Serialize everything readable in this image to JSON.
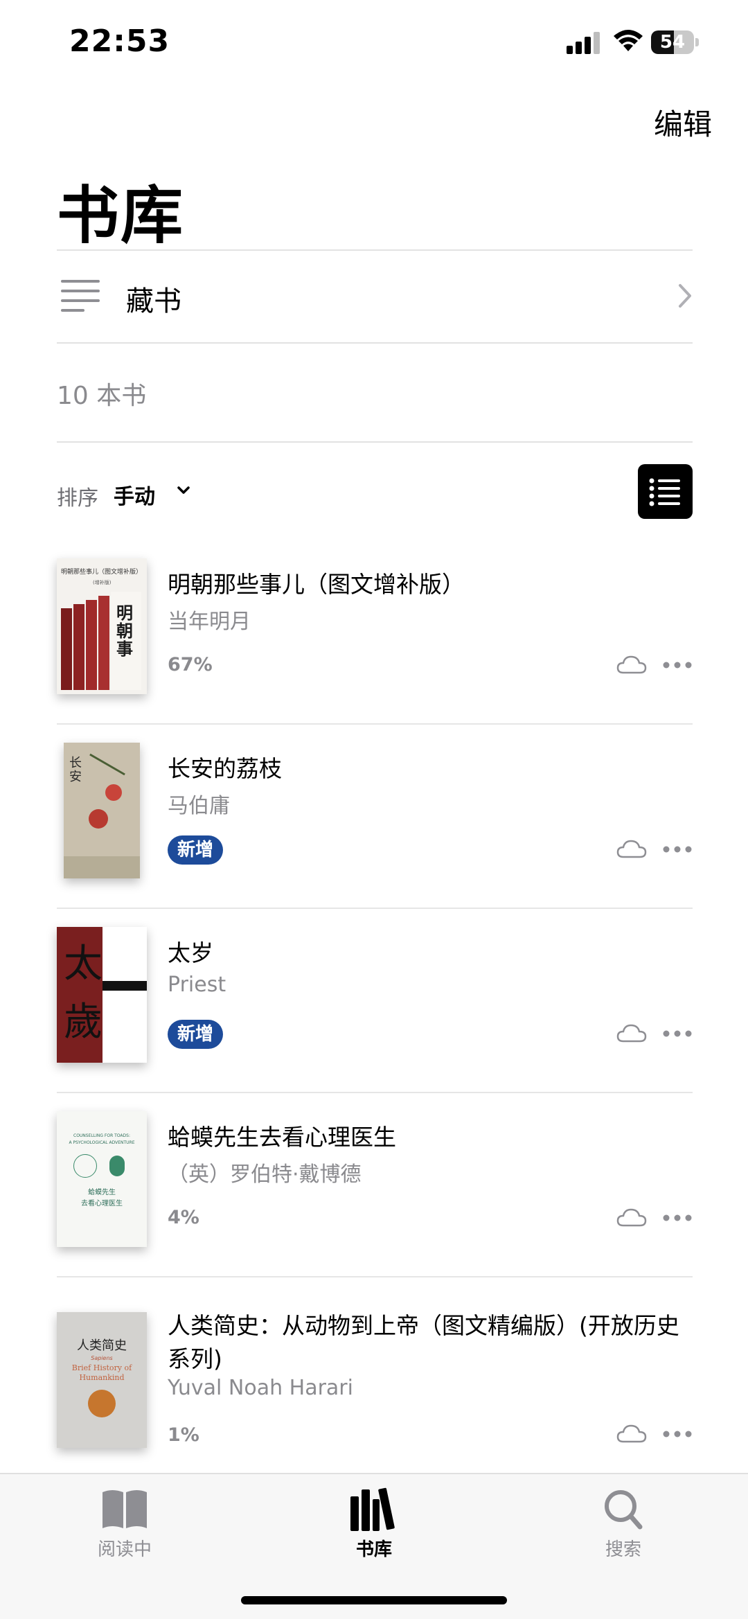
{
  "status": {
    "time": "22:53",
    "battery": "54",
    "battery_level": 0.54
  },
  "header": {
    "edit_label": "编辑",
    "title": "书库"
  },
  "collection": {
    "label": "藏书"
  },
  "book_count": "10 本书",
  "sort": {
    "label": "排序",
    "value": "手动"
  },
  "books": [
    {
      "title": "明朝那些事儿（图文增补版）",
      "author": "当年明月",
      "progress": "67%"
    },
    {
      "title": "长安的荔枝",
      "author": "马伯庸",
      "badge": "新增"
    },
    {
      "title": "太岁",
      "author": "Priest",
      "badge": "新增"
    },
    {
      "title": "蛤蟆先生去看心理医生",
      "author": "（英）罗伯特·戴博德",
      "progress": "4%"
    },
    {
      "title": "人类简史：从动物到上帝（图文精编版）(开放历史系列)",
      "author": "Yuval Noah Harari",
      "progress": "1%"
    }
  ],
  "covers": {
    "b0": {
      "heading": "明朝那些事儿（图文增补版）",
      "subheading": "(增补版)"
    },
    "b3": {
      "en1": "COUNSELLING FOR TOADS:",
      "en2": "A PSYCHOLOGICAL ADVENTURE",
      "cn1": "蛤蟆先生",
      "cn2": "去看心理医生"
    },
    "b4": {
      "cn": "人类简史",
      "en1": "Sapiens",
      "en2": "Brief History of",
      "en3": "Humankind"
    }
  },
  "tabs": [
    {
      "label": "阅读中",
      "icon": "book-open-icon",
      "active": false
    },
    {
      "label": "书库",
      "icon": "library-icon",
      "active": true
    },
    {
      "label": "搜索",
      "icon": "search-icon",
      "active": false
    }
  ],
  "colors": {
    "accent_badge": "#1d4b9a",
    "secondary_text": "#8a8a8e",
    "tab_inactive": "#8e8e93"
  }
}
